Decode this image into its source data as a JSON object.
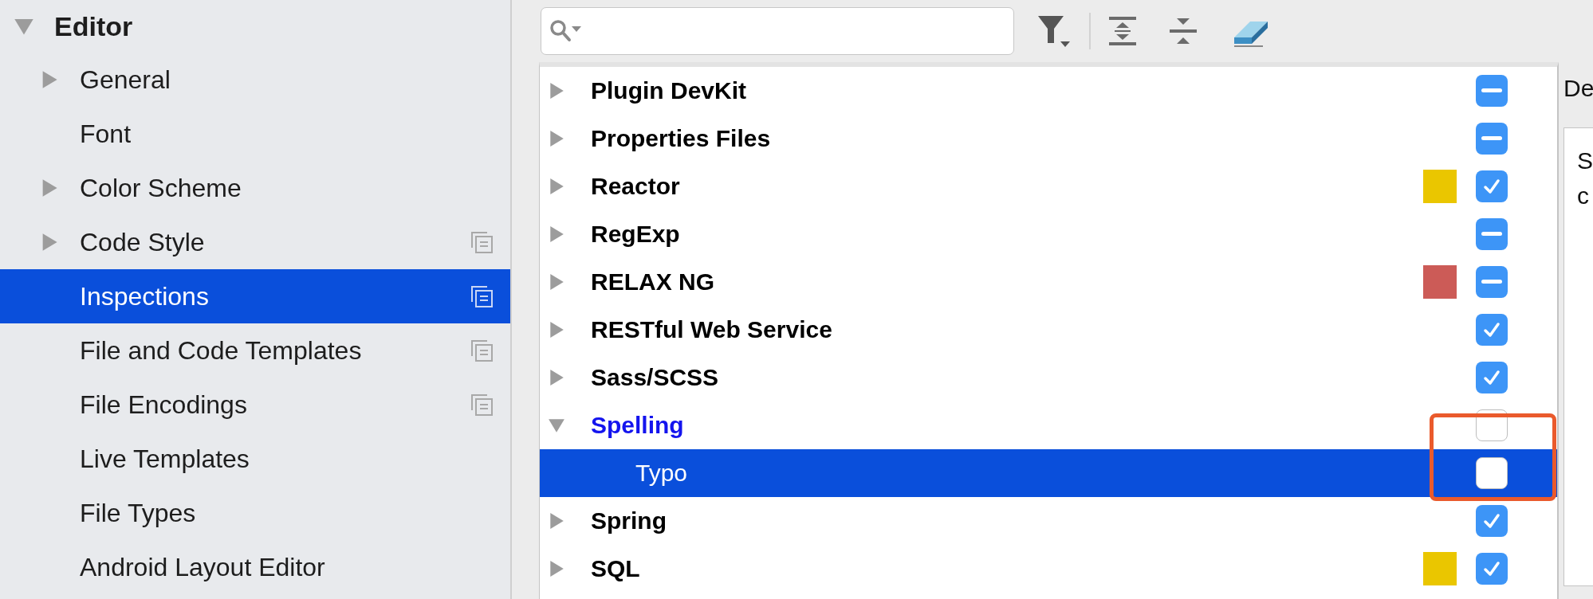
{
  "sidebar": {
    "items": [
      {
        "label": "Editor",
        "kind": "folder",
        "expanded": true,
        "selected": false,
        "scoped": false,
        "children": [
          {
            "label": "General",
            "kind": "folder",
            "expanded": false,
            "selected": false,
            "scoped": false
          },
          {
            "label": "Font",
            "kind": "leaf",
            "selected": false,
            "scoped": false
          },
          {
            "label": "Color Scheme",
            "kind": "folder",
            "expanded": false,
            "selected": false,
            "scoped": false
          },
          {
            "label": "Code Style",
            "kind": "folder",
            "expanded": false,
            "selected": false,
            "scoped": true
          },
          {
            "label": "Inspections",
            "kind": "leaf",
            "selected": true,
            "scoped": true
          },
          {
            "label": "File and Code Templates",
            "kind": "leaf",
            "selected": false,
            "scoped": true
          },
          {
            "label": "File Encodings",
            "kind": "leaf",
            "selected": false,
            "scoped": true
          },
          {
            "label": "Live Templates",
            "kind": "leaf",
            "selected": false,
            "scoped": false
          },
          {
            "label": "File Types",
            "kind": "leaf",
            "selected": false,
            "scoped": false
          },
          {
            "label": "Android Layout Editor",
            "kind": "leaf",
            "selected": false,
            "scoped": false
          }
        ]
      }
    ]
  },
  "inspections": {
    "rows": [
      {
        "label": "Plugin DevKit",
        "kind": "folder",
        "expanded": false,
        "checked": false,
        "partial": true,
        "selected": false,
        "modified": false,
        "highlighted": false
      },
      {
        "label": "Properties Files",
        "kind": "folder",
        "expanded": false,
        "checked": false,
        "partial": true,
        "selected": false,
        "modified": false,
        "highlighted": false
      },
      {
        "label": "Reactor",
        "kind": "folder",
        "expanded": false,
        "checked": true,
        "color": "#eac600",
        "selected": false,
        "modified": false,
        "highlighted": false
      },
      {
        "label": "RegExp",
        "kind": "folder",
        "expanded": false,
        "checked": false,
        "partial": true,
        "selected": false,
        "modified": false,
        "highlighted": false
      },
      {
        "label": "RELAX NG",
        "kind": "folder",
        "expanded": false,
        "checked": false,
        "partial": true,
        "color": "#cc5b57",
        "selected": false,
        "modified": false,
        "highlighted": false
      },
      {
        "label": "RESTful Web Service",
        "kind": "folder",
        "expanded": false,
        "checked": true,
        "selected": false,
        "modified": false,
        "highlighted": false
      },
      {
        "label": "Sass/SCSS",
        "kind": "folder",
        "expanded": false,
        "checked": true,
        "selected": false,
        "modified": false,
        "highlighted": false
      },
      {
        "label": "Spelling",
        "kind": "folder",
        "expanded": true,
        "checked": false,
        "selected": false,
        "modified": true,
        "highlighted": true,
        "children": [
          {
            "label": "Typo",
            "kind": "leaf",
            "checked": false,
            "selected": true,
            "modified": false,
            "highlighted": true
          }
        ]
      },
      {
        "label": "Spring",
        "kind": "folder",
        "expanded": false,
        "checked": true,
        "selected": false,
        "modified": false,
        "highlighted": false
      },
      {
        "label": "SQL",
        "kind": "folder",
        "expanded": false,
        "checked": true,
        "color": "#eac600",
        "selected": false,
        "modified": false,
        "highlighted": false
      }
    ]
  },
  "detail": {
    "heading": "De",
    "lines": [
      "S",
      "c"
    ]
  }
}
